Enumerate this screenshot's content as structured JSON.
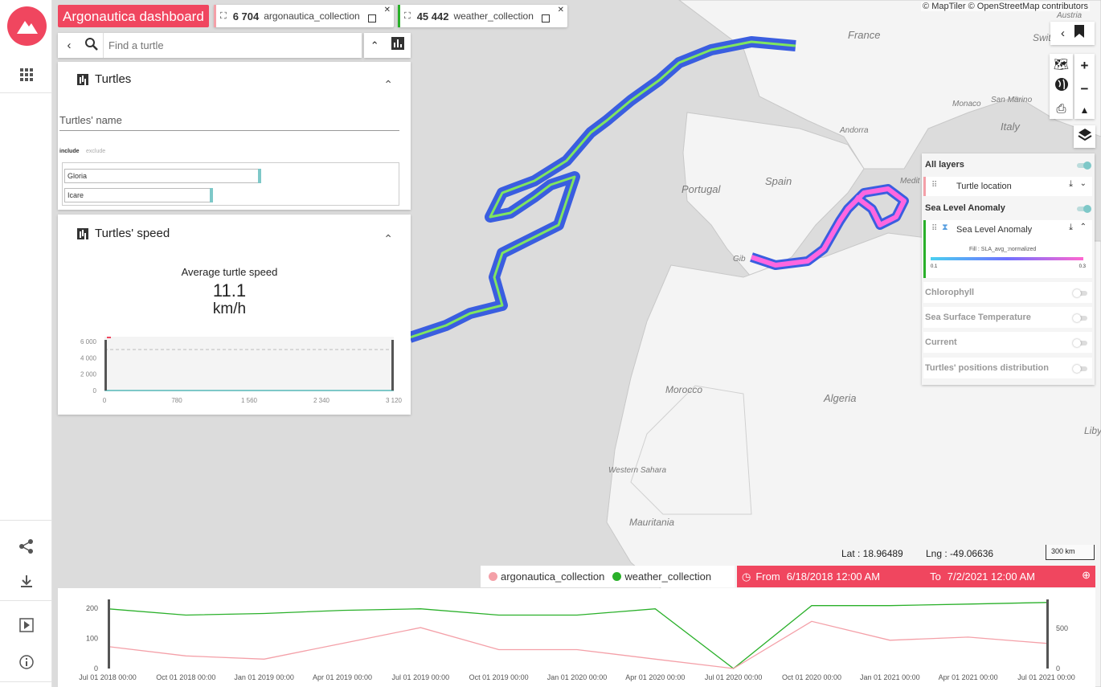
{
  "app": {
    "title": "Argonautica dashboard"
  },
  "collections": [
    {
      "count": "6 704",
      "name": "argonautica_collection",
      "color": "#f4a0a8"
    },
    {
      "count": "45 442",
      "name": "weather_collection",
      "color": "#2ab02a"
    }
  ],
  "search": {
    "placeholder": "Find a turtle"
  },
  "turtles_panel": {
    "title": "Turtles",
    "field_label": "Turtles' name",
    "include": "include",
    "exclude": "exclude",
    "items": [
      {
        "label": "Gloria",
        "fraction": 0.57
      },
      {
        "label": "Icare",
        "fraction": 0.43
      }
    ]
  },
  "speed_panel": {
    "title": "Turtles' speed",
    "avg_title": "Average turtle speed",
    "avg_value": "11.1",
    "avg_unit": "km/h",
    "chart_data": {
      "type": "bar",
      "y_ticks": [
        "6 000",
        "4 000",
        "2 000",
        "0"
      ],
      "x_ticks": [
        "0",
        "780",
        "1 560",
        "2 340",
        "3 120"
      ],
      "ylim": [
        0,
        6500
      ],
      "xlim": [
        0,
        3120
      ]
    }
  },
  "map": {
    "attribution": "© MapTiler © OpenStreetMap contributors",
    "labels": [
      "France",
      "Switzerland",
      "Austria",
      "Monaco",
      "San Marino",
      "Italy",
      "Andorra",
      "Portugal",
      "Spain",
      "Medit",
      "Gib",
      "Morocco",
      "Algeria",
      "Western Sahara",
      "Mauritania",
      "Libya"
    ],
    "lat_label": "Lat : 18.96489",
    "lng_label": "Lng : -49.06636",
    "scale": "300 km"
  },
  "layers": {
    "all_layers": "All layers",
    "turtle_location": "Turtle location",
    "sla_group": "Sea Level Anomaly",
    "sla_layer": "Sea Level Anomaly",
    "fill_label": "Fill : SLA_avg_:normalized",
    "fill_min": "0.1",
    "fill_max": "0.3",
    "disabled": [
      "Chlorophyll",
      "Sea Surface Temperature",
      "Current",
      "Turtles' positions distribution"
    ]
  },
  "timeline": {
    "legend": [
      "argonautica_collection",
      "weather_collection"
    ],
    "from_label": "From",
    "from_value": "6/18/2018 12:00 AM",
    "to_label": "To",
    "to_value": "7/2/2021 12:00 AM",
    "chart_data": {
      "type": "line",
      "x": [
        "Jul 01 2018 00:00",
        "Oct 01 2018 00:00",
        "Jan 01 2019 00:00",
        "Apr 01 2019 00:00",
        "Jul 01 2019 00:00",
        "Oct 01 2019 00:00",
        "Jan 01 2020 00:00",
        "Apr 01 2020 00:00",
        "Jul 01 2020 00:00",
        "Oct 01 2020 00:00",
        "Jan 01 2021 00:00",
        "Apr 01 2021 00:00",
        "Jul 01 2021 00:00"
      ],
      "left_ticks": [
        "200",
        "100",
        "0"
      ],
      "right_ticks": [
        "500",
        "0"
      ],
      "series": [
        {
          "name": "weather_collection",
          "color": "#2ab02a",
          "values": [
            190,
            170,
            175,
            185,
            190,
            170,
            170,
            190,
            0,
            200,
            200,
            205,
            210
          ]
        },
        {
          "name": "argonautica_collection",
          "color": "#f4a0a8",
          "values": [
            70,
            40,
            30,
            80,
            130,
            60,
            60,
            30,
            0,
            150,
            90,
            100,
            80
          ]
        }
      ]
    }
  }
}
